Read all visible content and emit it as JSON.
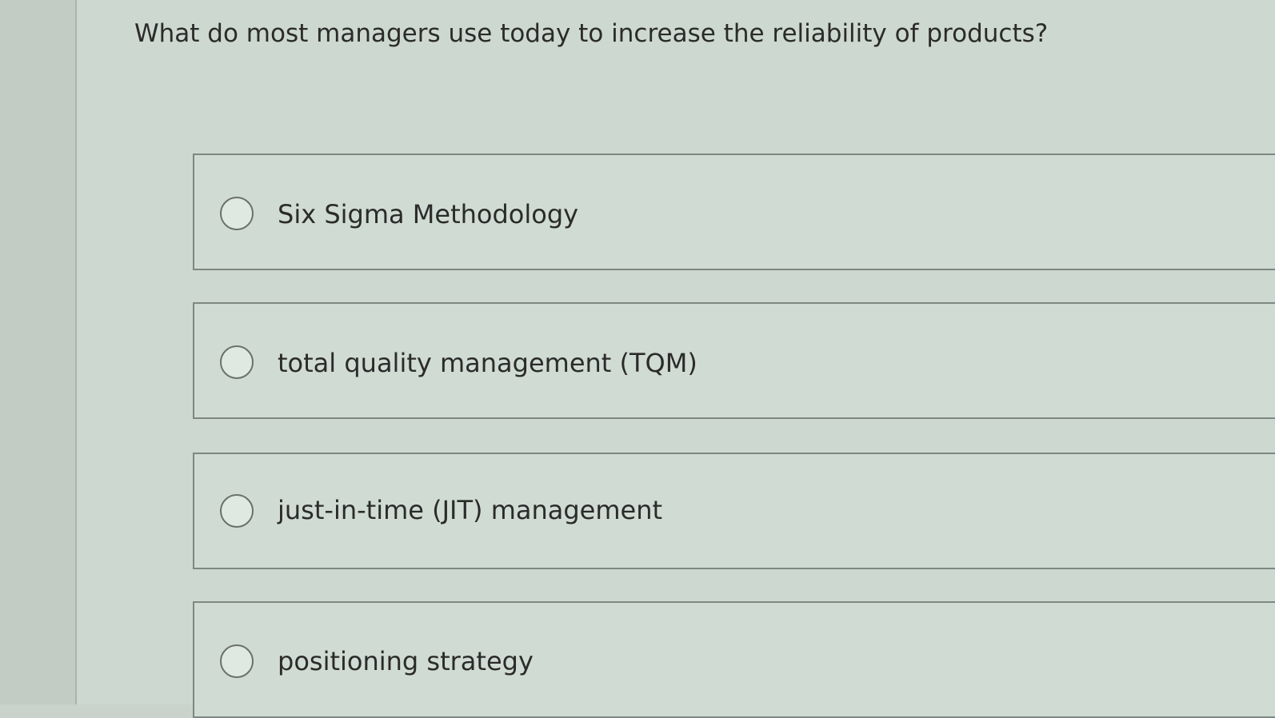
{
  "question": {
    "text": "What do most managers use today to increase the reliability of products?"
  },
  "options": [
    {
      "label": "Six Sigma Methodology",
      "selected": false
    },
    {
      "label": "total quality management (TQM)",
      "selected": false
    },
    {
      "label": "just-in-time (JIT) management",
      "selected": false
    },
    {
      "label": "positioning strategy",
      "selected": false
    }
  ],
  "colors": {
    "background": "#cdd8d0",
    "border": "#7f8783",
    "text": "#2b2b2b"
  }
}
